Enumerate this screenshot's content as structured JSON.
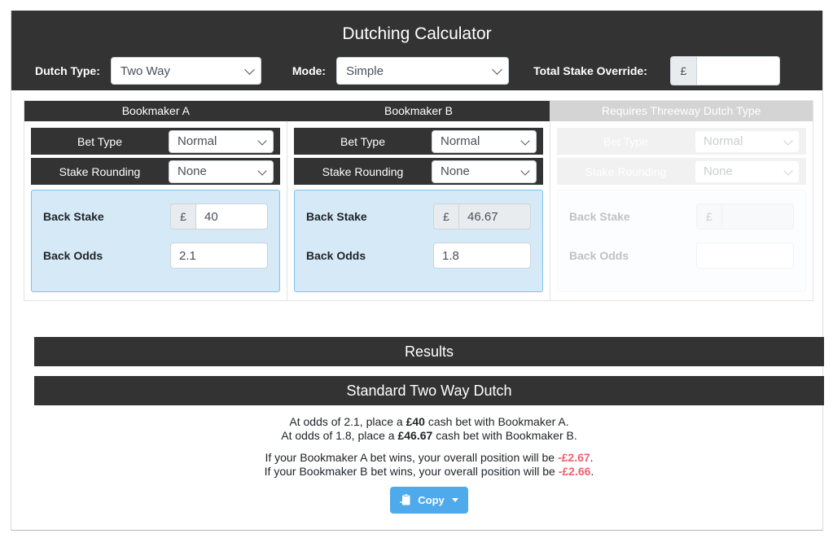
{
  "header": {
    "title": "Dutching Calculator",
    "dutch_type_label": "Dutch Type:",
    "dutch_type_value": "Two Way",
    "mode_label": "Mode:",
    "mode_value": "Simple",
    "override_label": "Total Stake Override:",
    "override_currency": "£",
    "override_value": ""
  },
  "columns": [
    {
      "heading": "Bookmaker A",
      "disabled": false,
      "bet_type_label": "Bet Type",
      "bet_type_value": "Normal",
      "stake_rounding_label": "Stake Rounding",
      "stake_rounding_value": "None",
      "back_stake_label": "Back Stake",
      "back_stake_currency": "£",
      "back_stake_value": "40",
      "back_odds_label": "Back Odds",
      "back_odds_value": "2.1"
    },
    {
      "heading": "Bookmaker B",
      "disabled": false,
      "bet_type_label": "Bet Type",
      "bet_type_value": "Normal",
      "stake_rounding_label": "Stake Rounding",
      "stake_rounding_value": "None",
      "back_stake_label": "Back Stake",
      "back_stake_currency": "£",
      "back_stake_value": "46.67",
      "back_odds_label": "Back Odds",
      "back_odds_value": "1.8"
    },
    {
      "heading": "Requires Threeway Dutch Type",
      "disabled": true,
      "bet_type_label": "Bet Type",
      "bet_type_value": "Normal",
      "stake_rounding_label": "Stake Rounding",
      "stake_rounding_value": "None",
      "back_stake_label": "Back Stake",
      "back_stake_currency": "£",
      "back_stake_value": "",
      "back_odds_label": "Back Odds",
      "back_odds_value": ""
    }
  ],
  "results": {
    "title": "Results",
    "subtitle": "Standard Two Way Dutch",
    "line1_pre": "At odds of 2.1, place a ",
    "line1_amount": "£40",
    "line1_post": " cash bet with Bookmaker A.",
    "line2_pre": "At odds of 1.8, place a ",
    "line2_amount": "£46.67",
    "line2_post": " cash bet with Bookmaker B.",
    "line3_pre": "If your Bookmaker A bet wins, your overall position will be ",
    "line3_amount": "-£2.67",
    "line3_post": ".",
    "line4_pre": "If your Bookmaker B bet wins, your overall position will be ",
    "line4_amount": "-£2.66",
    "line4_post": ".",
    "copy_label": "Copy"
  },
  "colors": {
    "dark": "#333333",
    "accent_blue": "#4eaaea",
    "panel_blue": "#d5e9f7",
    "negative": "#f0616d"
  }
}
